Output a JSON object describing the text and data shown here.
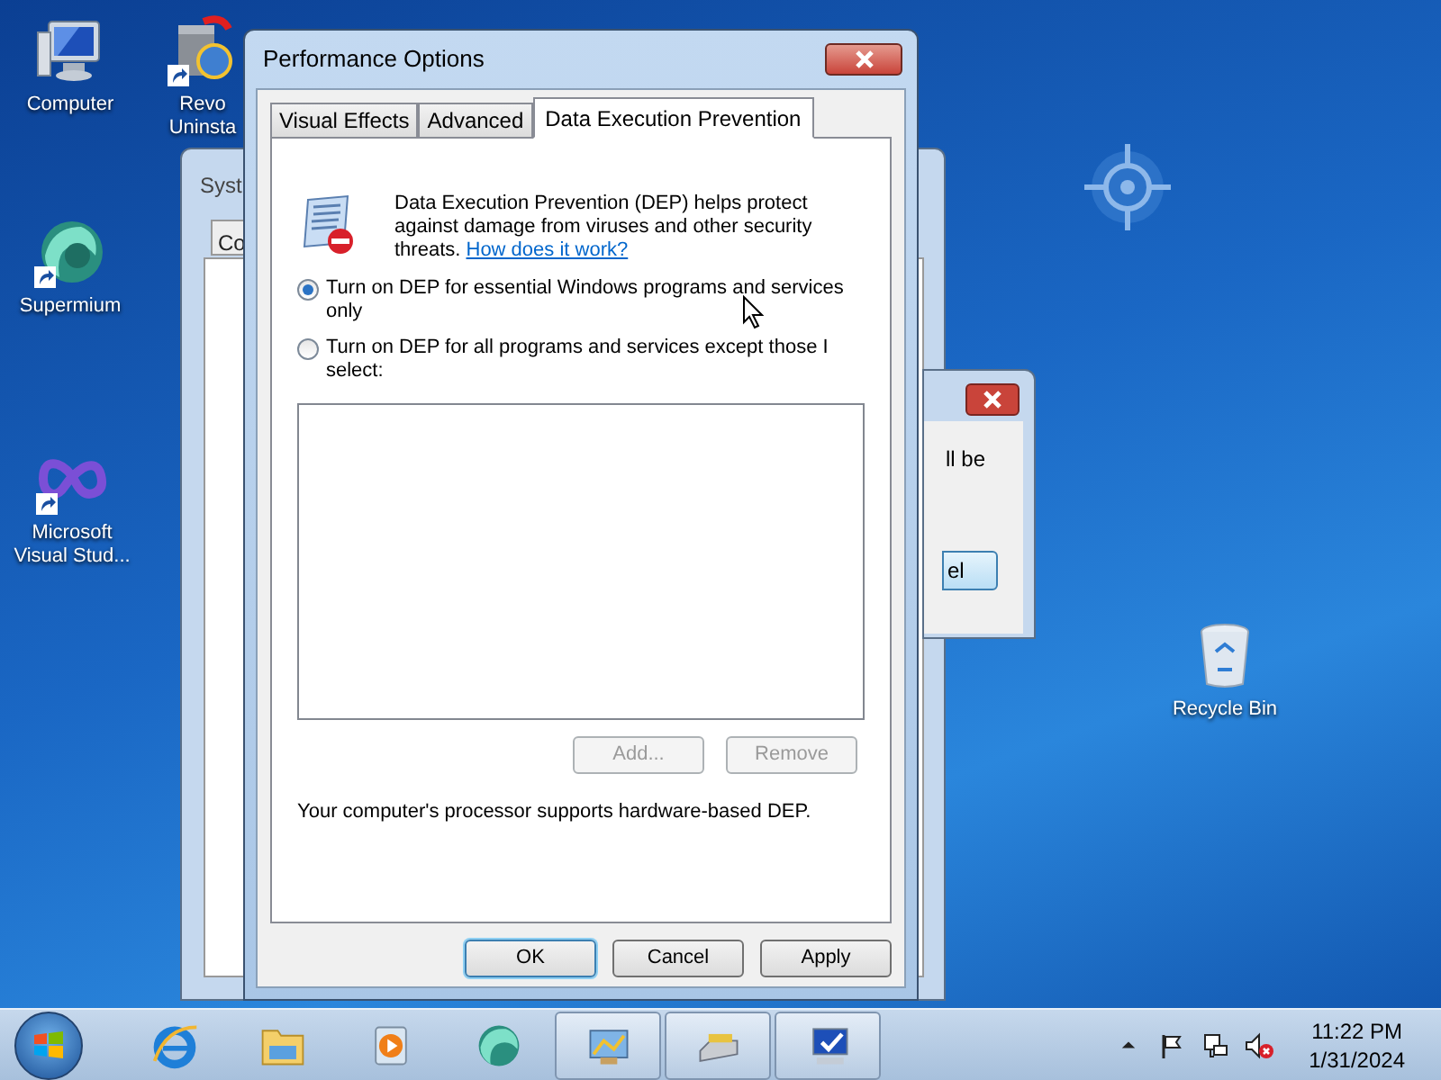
{
  "desktop_icons": [
    {
      "label": "Computer",
      "kind": "computer"
    },
    {
      "label": "Revo Uninsta",
      "kind": "revo"
    },
    {
      "label": "Supermium",
      "kind": "supermium"
    },
    {
      "label": "Microsoft Visual Stud...",
      "kind": "vs"
    },
    {
      "label": "Recycle Bin",
      "kind": "recycle"
    }
  ],
  "background_window": {
    "title": "Syst",
    "tab": "Co"
  },
  "message_box": {
    "text": "ll be",
    "button": "el"
  },
  "dialog": {
    "title": "Performance Options",
    "tabs": [
      {
        "label": "Visual Effects",
        "selected": false
      },
      {
        "label": "Advanced",
        "selected": false
      },
      {
        "label": "Data Execution Prevention",
        "selected": true
      }
    ],
    "description": "Data Execution Prevention (DEP) helps protect against damage from viruses and other security threats.",
    "link": "How does it work?",
    "options": [
      {
        "label": "Turn on DEP for essential Windows programs and services only",
        "selected": true
      },
      {
        "label": "Turn on DEP for all programs and services except those I select:",
        "selected": false
      }
    ],
    "list_buttons": [
      {
        "label": "Add...",
        "disabled": true
      },
      {
        "label": "Remove",
        "disabled": true
      }
    ],
    "status": "Your computer's processor supports hardware-based DEP.",
    "buttons": [
      {
        "label": "OK",
        "default": true
      },
      {
        "label": "Cancel",
        "default": false
      },
      {
        "label": "Apply",
        "default": false
      }
    ]
  },
  "taskbar": {
    "items": [
      {
        "kind": "ie",
        "active": false
      },
      {
        "kind": "explorer",
        "active": false
      },
      {
        "kind": "media",
        "active": false
      },
      {
        "kind": "supermium",
        "active": false
      },
      {
        "kind": "performance",
        "active": true
      },
      {
        "kind": "drive",
        "active": true
      },
      {
        "kind": "system",
        "active": true
      }
    ],
    "clock": {
      "time": "11:22 PM",
      "date": "1/31/2024"
    }
  }
}
